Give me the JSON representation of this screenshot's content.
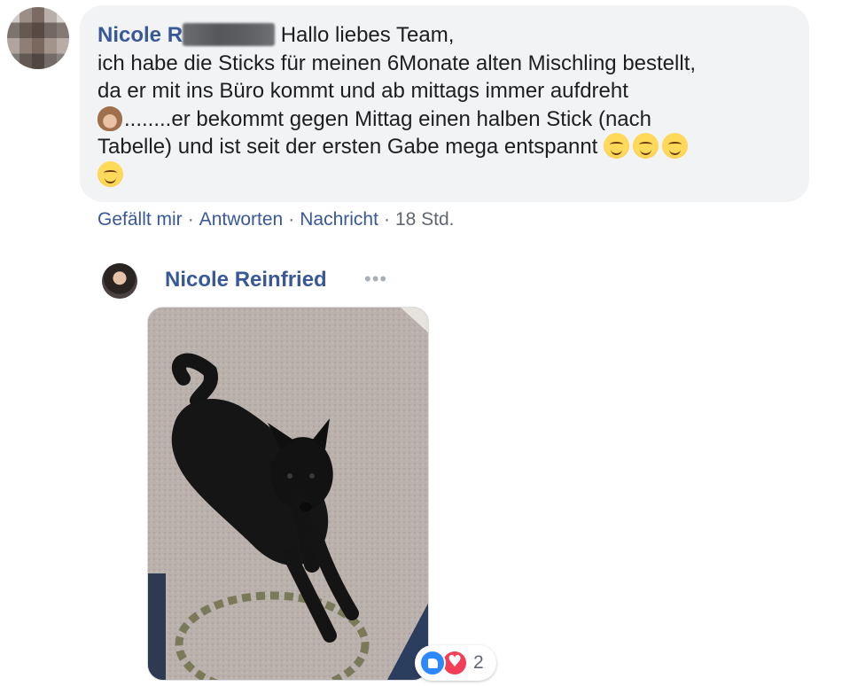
{
  "comment": {
    "author_visible": "Nicole R",
    "line1": " Hallo liebes Team,",
    "line2": "ich habe die Sticks für meinen 6Monate alten Mischling bestellt,",
    "line3": "da er mit ins Büro kommt und ab mittags immer aufdreht",
    "line4": "........er bekommt gegen Mittag einen halben Stick (nach",
    "line5": "Tabelle) und ist seit der ersten Gabe mega entspannt ",
    "actions": {
      "like": "Gefällt mir",
      "reply": "Antworten",
      "message": "Nachricht",
      "separator": "·",
      "time": "18 Std."
    }
  },
  "reply": {
    "author": "Nicole Reinfried",
    "more": "•••",
    "reaction_count": "2"
  },
  "icons": {
    "emoji": "smiling-face-with-smiling-eyes",
    "monkey": "see-no-evil-monkey",
    "reactions": [
      "like",
      "love"
    ]
  },
  "colors": {
    "link": "#385898",
    "bubble": "#f2f3f5",
    "like": "#2d88ff",
    "love": "#f33e58"
  }
}
